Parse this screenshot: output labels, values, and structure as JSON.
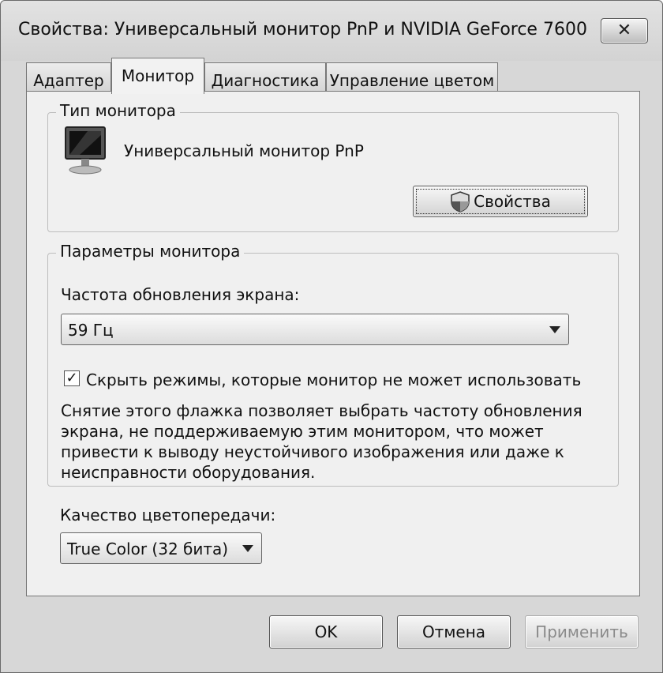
{
  "window": {
    "title": "Свойства: Универсальный монитор PnP и NVIDIA GeForce 7600 ...",
    "close_symbol": "✕"
  },
  "tabs": [
    {
      "label": "Адаптер",
      "active": false
    },
    {
      "label": "Монитор",
      "active": true
    },
    {
      "label": "Диагностика",
      "active": false
    },
    {
      "label": "Управление цветом",
      "active": false
    }
  ],
  "monitor_type": {
    "group_label": "Тип монитора",
    "monitor_icon": "monitor-icon",
    "monitor_name": "Универсальный монитор PnP",
    "properties_button": "Свойства",
    "properties_icon": "shield-icon"
  },
  "monitor_settings": {
    "group_label": "Параметры монитора",
    "refresh_label": "Частота обновления экрана:",
    "refresh_value": "59 Гц",
    "hide_modes_checked": true,
    "hide_modes_label": "Скрыть режимы, которые монитор не может использовать",
    "hide_modes_description": "Снятие этого флажка позволяет выбрать частоту обновления экрана, не поддерживаемую этим монитором, что может привести к выводу неустойчивого изображения или даже к неисправности оборудования."
  },
  "color_quality": {
    "label": "Качество цветопередачи:",
    "value": "True Color (32 бита)"
  },
  "footer": {
    "ok": "OK",
    "cancel": "Отмена",
    "apply": "Применить"
  },
  "colors": {
    "window_bg": "#d7d7d7",
    "panel_bg": "#f0f0f0"
  }
}
